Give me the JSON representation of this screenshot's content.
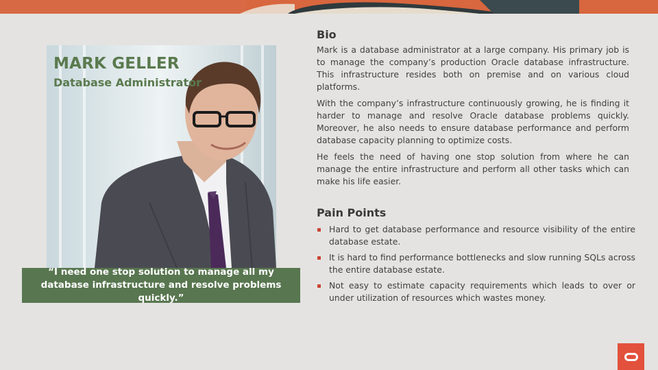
{
  "persona": {
    "name": "MARK GELLER",
    "role": "Database Administrator",
    "quote": "“I need one stop solution to manage all my database infrastructure and resolve problems quickly.”"
  },
  "bio": {
    "title": "Bio",
    "paragraphs": [
      "Mark is a database administrator at a large company. His primary job is to manage the company’s production Oracle database infrastructure. This infrastructure resides both on premise and on various cloud platforms.",
      "With the company’s infrastructure continuously growing, he is finding it harder to manage and resolve Oracle database problems quickly. Moreover, he also needs to ensure database performance and perform database capacity planning to optimize costs.",
      "He feels the need of having one stop solution from where he can manage the entire infrastructure and perform all other tasks which can make his life easier."
    ]
  },
  "pain_points": {
    "title": "Pain Points",
    "items": [
      "Hard to get database performance and resource visibility of the entire database estate.",
      "It is hard to find performance bottlenecks and slow running SQLs across the entire database estate.",
      "Not easy to estimate capacity requirements which leads to over or under utilization of resources which wastes money."
    ]
  },
  "colors": {
    "accent_green": "#58764f",
    "bullet_red": "#c74634",
    "brand_red": "#e2513c",
    "background": "#e4e3e1"
  },
  "icons": {
    "brand_logo": "oracle-logo-icon",
    "bullet": "square-bullet-icon"
  }
}
